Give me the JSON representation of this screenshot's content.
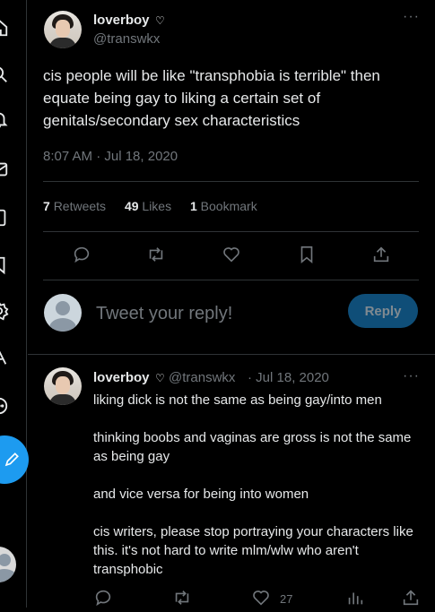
{
  "tweet": {
    "author_name": "loverboy",
    "author_badge": "♡",
    "author_handle": "@transwkx",
    "more": "···",
    "text": "cis people will be like \"transphobia is terrible\" then equate being gay to liking a certain set of genitals/secondary sex characteristics",
    "timestamp": "8:07 AM · Jul 18, 2020",
    "retweets_count": "7",
    "retweets_label": "Retweets",
    "likes_count": "49",
    "likes_label": "Likes",
    "bookmarks_count": "1",
    "bookmarks_label": "Bookmark"
  },
  "reply_box": {
    "placeholder": "Tweet your reply!",
    "button_label": "Reply"
  },
  "reply": {
    "author_name": "loverboy",
    "author_badge": "♡",
    "author_handle": "@transwkx",
    "date": "· Jul 18, 2020",
    "more": "···",
    "paragraphs": [
      "liking dick is not the same as being gay/into men",
      "thinking boobs and vaginas are gross is not the same as being gay",
      "and vice versa for being into women",
      "cis writers, please stop portraying your characters like this. it's not hard to write mlm/wlw who aren't transphobic"
    ],
    "like_count": "27"
  },
  "icons": {
    "sidebar": [
      "home-icon",
      "explore-icon",
      "notifications-icon",
      "messages-icon",
      "bookmarks-icon",
      "lists-icon",
      "settings-icon",
      "communities-icon",
      "more-icon",
      "compose-icon"
    ],
    "actions": [
      "reply-icon",
      "retweet-icon",
      "like-icon",
      "bookmark-icon",
      "share-icon",
      "views-icon"
    ]
  },
  "colors": {
    "background": "#000000",
    "text": "#e7e9ea",
    "muted": "#71767b",
    "accent": "#1d9bf0",
    "divider": "#2f3336"
  }
}
